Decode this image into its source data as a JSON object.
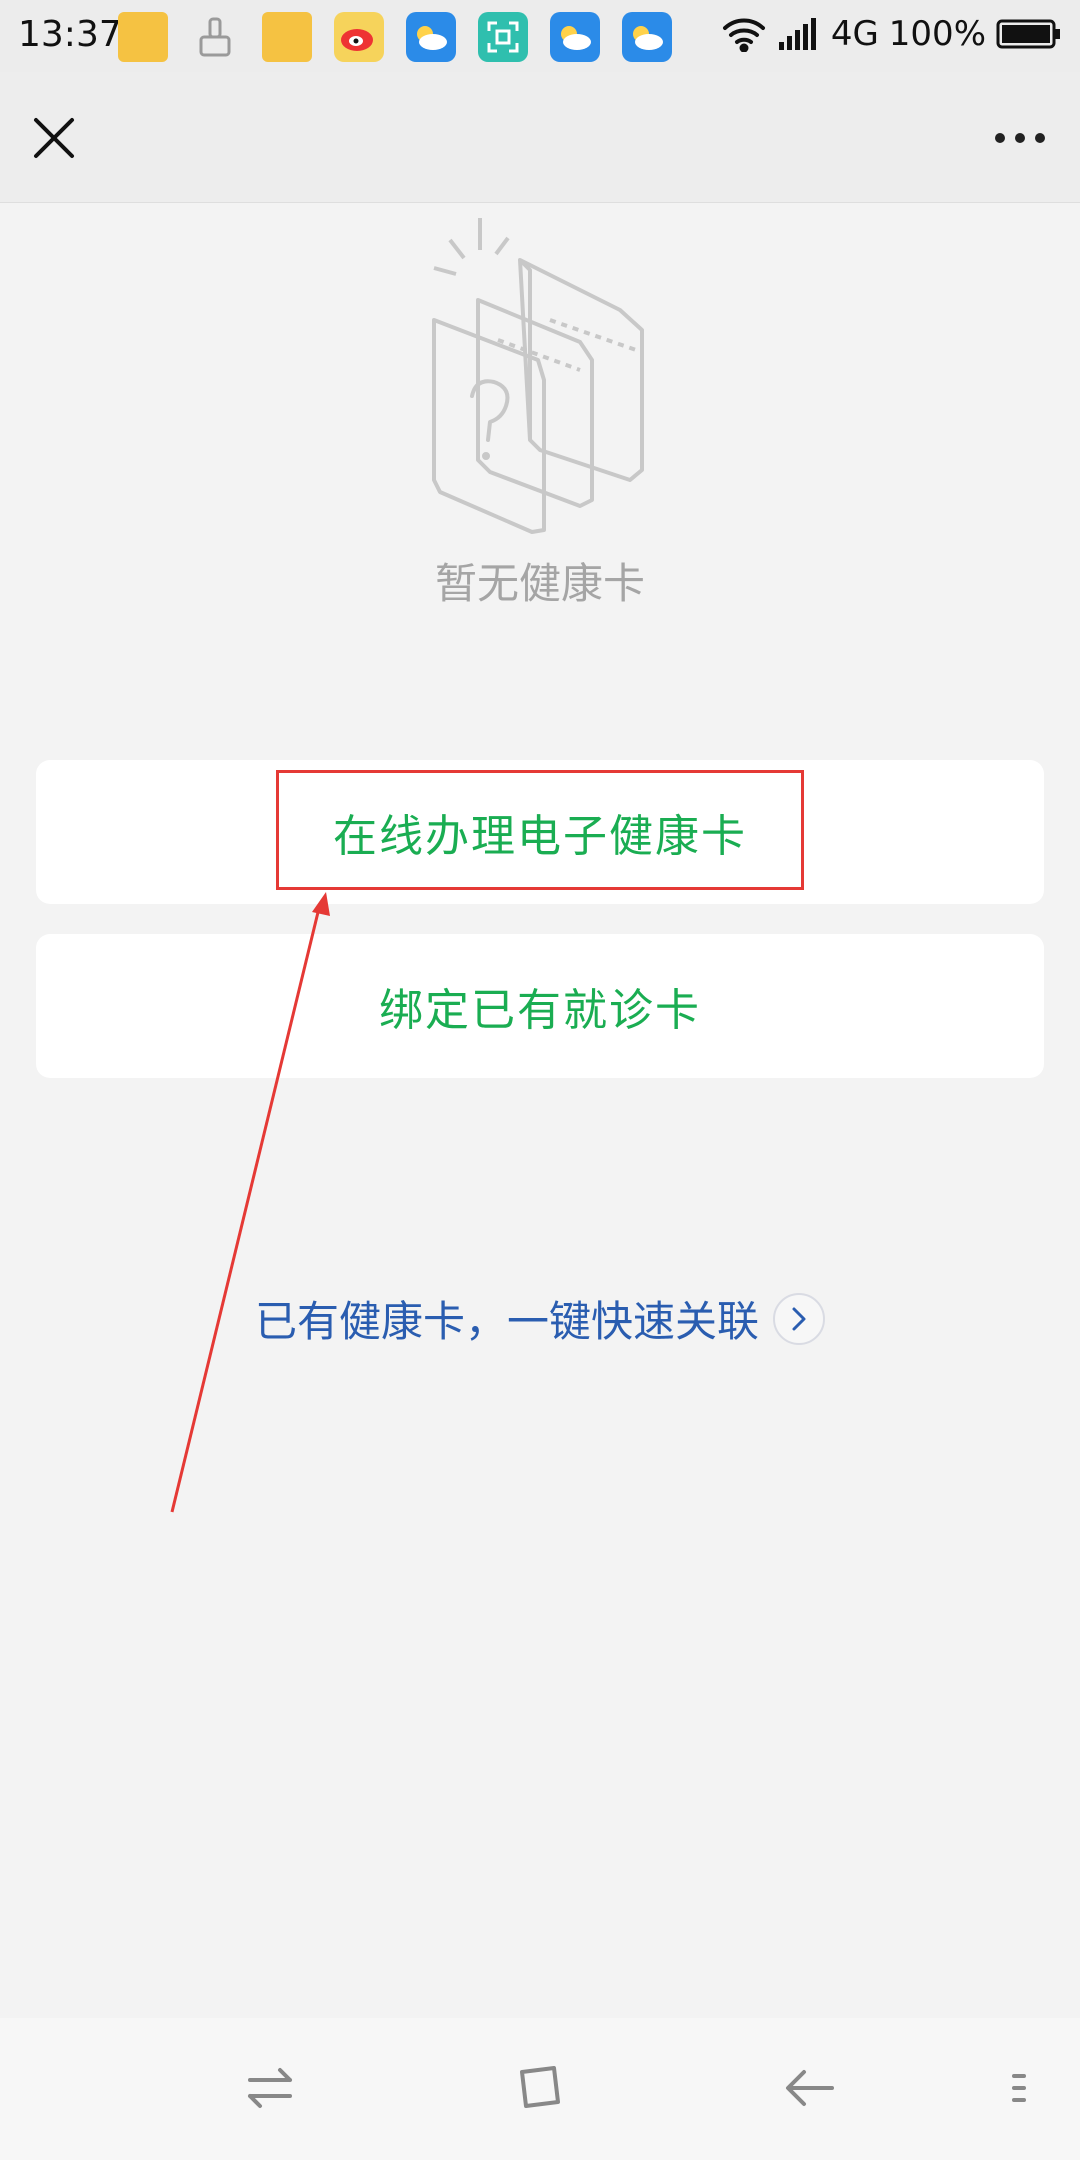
{
  "status_bar": {
    "time": "13:37",
    "network": "4G",
    "battery": "100%",
    "notification_icons": [
      "folder-icon",
      "paintbrush-icon",
      "folder-icon",
      "weibo-icon",
      "weather-icon",
      "scan-icon",
      "weather-icon",
      "weather-icon"
    ]
  },
  "title_bar": {
    "close_icon": "close-icon",
    "more_icon": "more-icon"
  },
  "empty_state": {
    "message": "暂无健康卡",
    "icon": "empty-cards-icon"
  },
  "actions": {
    "apply_label": "在线办理电子健康卡",
    "bind_label": "绑定已有就诊卡"
  },
  "link": {
    "label": "已有健康卡，一键快速关联",
    "icon": "chevron-right-icon"
  },
  "colors": {
    "accent_green": "#1aad52",
    "link_blue": "#2a5db0",
    "annotation_red": "#e53935",
    "background": "#f3f3f3"
  }
}
